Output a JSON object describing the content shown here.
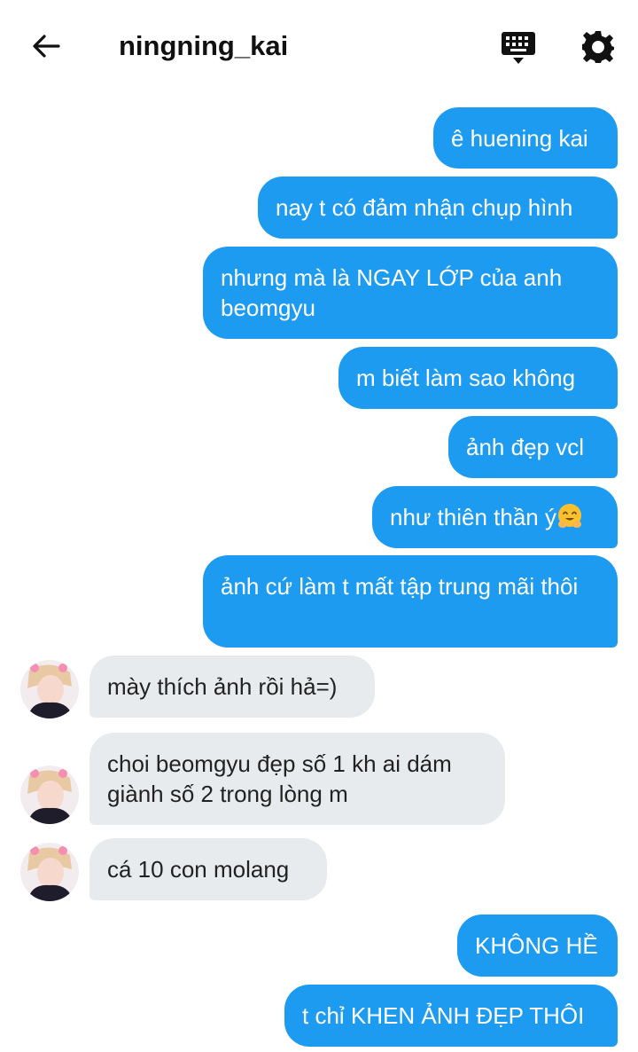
{
  "header": {
    "username": "ningning_kai",
    "back_icon": "arrow-left-icon",
    "keyboard_icon": "keyboard-icon",
    "settings_icon": "gear-icon"
  },
  "colors": {
    "outgoing": "#1d9bf0",
    "incoming": "#e8ebee"
  },
  "messages": [
    {
      "sender": "me",
      "text": "ê huening kai"
    },
    {
      "sender": "me",
      "text": "nay t có đảm nhận chụp hình"
    },
    {
      "sender": "me",
      "text": "nhưng mà là NGAY LỚP của anh beomgyu"
    },
    {
      "sender": "me",
      "text": "m biết làm sao không"
    },
    {
      "sender": "me",
      "text": "ảnh đẹp vcl"
    },
    {
      "sender": "me",
      "text": "như thiên thần ý",
      "emoji": "smiling-face-with-open-hands-emoji"
    },
    {
      "sender": "me",
      "text": "ảnh cứ làm t mất tập trung mãi thôi"
    },
    {
      "sender": "them",
      "text": "mày thích ảnh rồi hả=)"
    },
    {
      "sender": "them",
      "text": "choi beomgyu đẹp số 1 kh ai dám giành số 2 trong lòng m"
    },
    {
      "sender": "them",
      "text": "cá 10 con molang"
    },
    {
      "sender": "me",
      "text": "KHÔNG HỀ"
    },
    {
      "sender": "me",
      "text": "t chỉ KHEN ẢNH ĐẸP THÔI"
    }
  ]
}
